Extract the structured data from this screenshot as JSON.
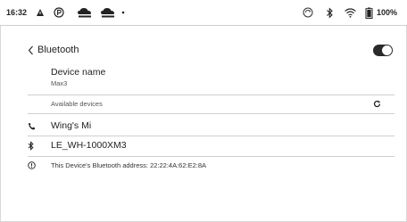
{
  "status_bar": {
    "time": "16:32",
    "battery_percent": "100%",
    "icons": [
      "alert-icon",
      "p-app-icon",
      "cloud-sync-icon",
      "cloud-sync-icon",
      "more-dot-icon",
      "sync-icon",
      "bluetooth-icon",
      "wifi-icon",
      "battery-icon"
    ]
  },
  "header": {
    "back_label": "Bluetooth",
    "toggle_on": true
  },
  "device_name": {
    "label": "Device name",
    "value": "Max3"
  },
  "available": {
    "title": "Available devices"
  },
  "devices": [
    {
      "name": "Wing's Mi",
      "icon": "phone-icon"
    },
    {
      "name": "LE_WH-1000XM3",
      "icon": "bluetooth-icon"
    }
  ],
  "info": {
    "text": "This Device's Bluetooth address: 22:22:4A:62:E2:8A"
  }
}
